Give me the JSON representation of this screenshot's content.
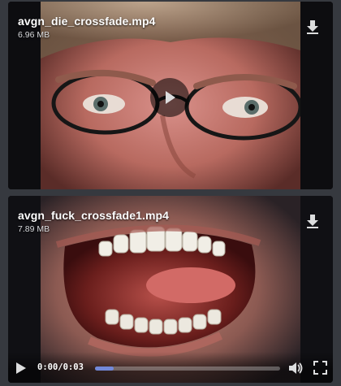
{
  "attachments": [
    {
      "file_name": "avgn_die_crossfade.mp4",
      "file_size": "6.96 MB"
    },
    {
      "file_name": "avgn_fuck_crossfade1.mp4",
      "file_size": "7.89 MB",
      "player": {
        "current_time": "0:00",
        "separator": "/",
        "duration": "0:03",
        "progress_fraction": 0.1
      }
    }
  ],
  "colors": {
    "background": "#36393f",
    "progress_accent": "#7289da"
  },
  "icons": [
    "download-icon",
    "play-icon",
    "volume-icon",
    "fullscreen-icon"
  ]
}
